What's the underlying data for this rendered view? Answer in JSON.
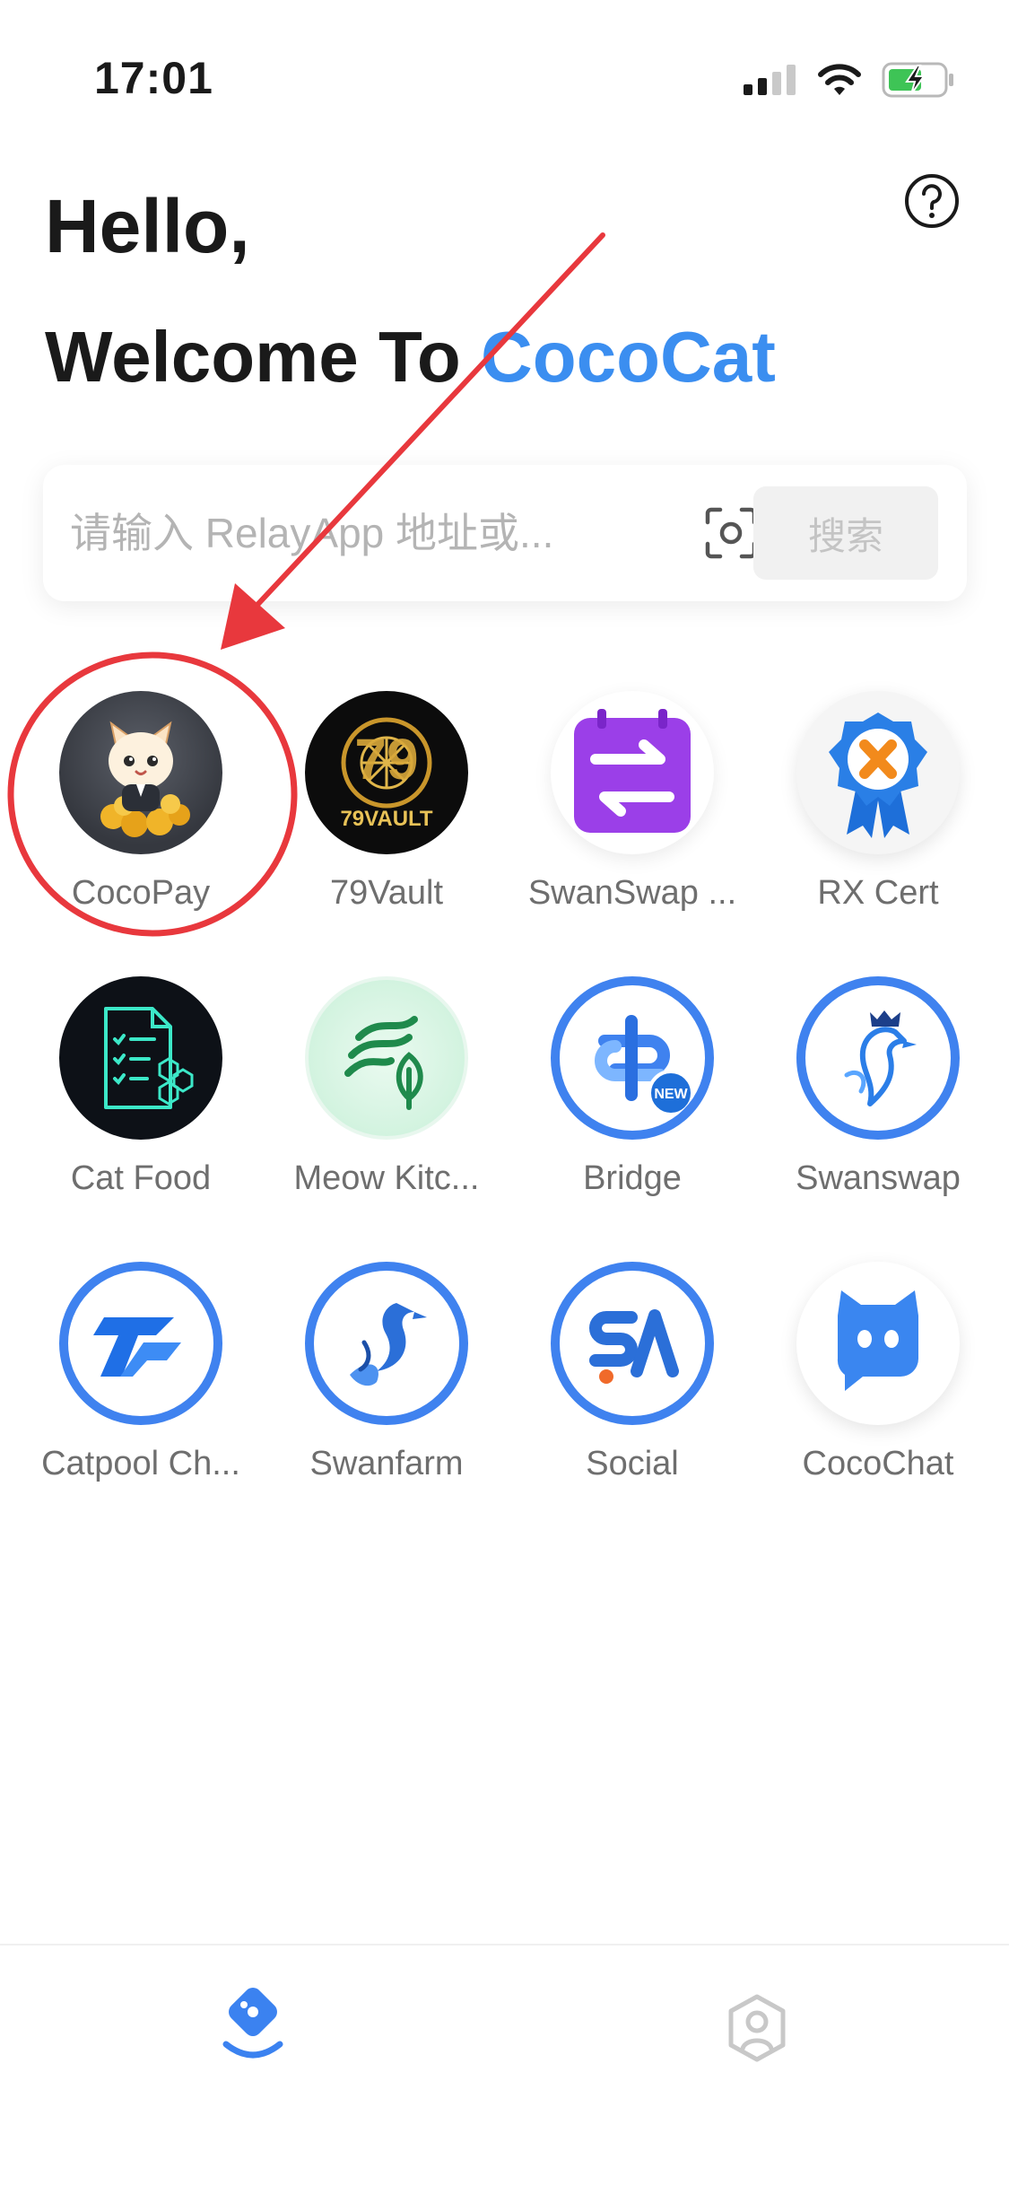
{
  "status_bar": {
    "time": "17:01"
  },
  "greeting": "Hello,",
  "welcome": {
    "prefix": "Welcome To ",
    "brand": "CocoCat"
  },
  "search": {
    "placeholder": "请输入 RelayApp 地址或...",
    "button_label": "搜索"
  },
  "apps": [
    {
      "label": "CocoPay",
      "icon": "cocopay-cat-icon"
    },
    {
      "label": "79Vault",
      "icon": "79vault-logo-icon"
    },
    {
      "label": "SwanSwap ...",
      "icon": "swap-arrows-icon"
    },
    {
      "label": "RX Cert",
      "icon": "certificate-ribbon-icon"
    },
    {
      "label": "Cat Food",
      "icon": "checklist-document-icon"
    },
    {
      "label": "Meow Kitc...",
      "icon": "leaf-logo-icon"
    },
    {
      "label": "Bridge",
      "icon": "bridge-logo-icon"
    },
    {
      "label": "Swanswap",
      "icon": "swan-crown-icon"
    },
    {
      "label": "Catpool Ch...",
      "icon": "catpool-logo-icon"
    },
    {
      "label": "Swanfarm",
      "icon": "swan-logo-icon"
    },
    {
      "label": "Social",
      "icon": "social-logo-icon"
    },
    {
      "label": "CocoChat",
      "icon": "chat-cat-icon"
    }
  ],
  "bridge_badge": "NEW",
  "colors": {
    "brand": "#3b8ef0",
    "annotation": "#e8383d",
    "tab_active": "#3b82f0",
    "tab_inactive": "#c8c8c8"
  },
  "tab_bar": {
    "items": [
      {
        "icon": "home-compass-icon",
        "active": true
      },
      {
        "icon": "profile-hexagon-icon",
        "active": false
      }
    ]
  }
}
